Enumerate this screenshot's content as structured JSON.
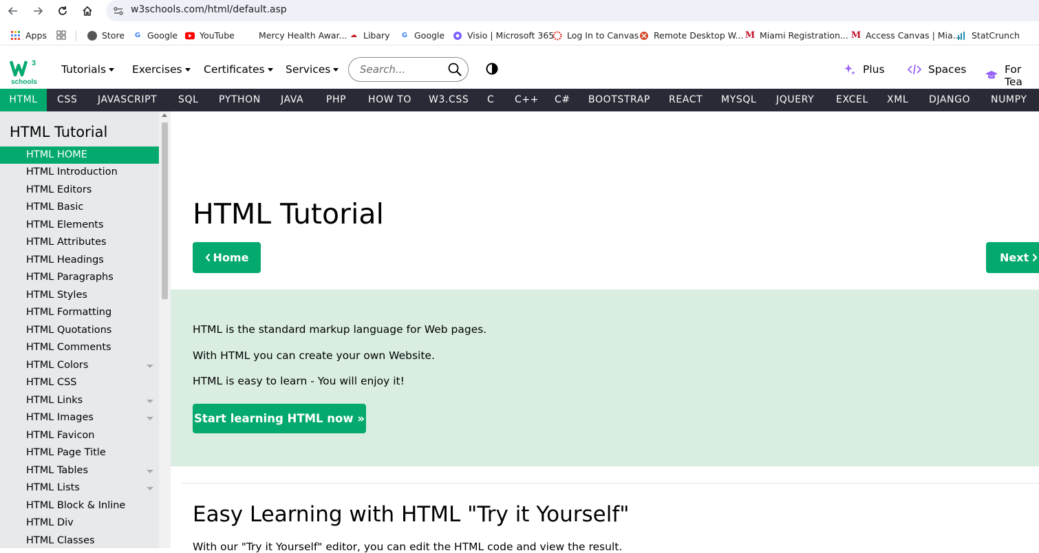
{
  "browser": {
    "url": "w3schools.com/html/default.asp",
    "bookmarks": [
      "Apps",
      "Store",
      "Google",
      "YouTube",
      "Mercy Health Awar...",
      "Libary",
      "Google",
      "Visio | Microsoft 365",
      "Log In to Canvas",
      "Remote Desktop W...",
      "Miami Registration...",
      "Access Canvas | Mia...",
      "StatCrunch"
    ]
  },
  "topnav": {
    "menus": [
      "Tutorials",
      "Exercises",
      "Certificates",
      "Services"
    ],
    "search_placeholder": "Search...",
    "right_links": [
      "Plus",
      "Spaces",
      "For Tea"
    ]
  },
  "subjects": [
    "HTML",
    "CSS",
    "JAVASCRIPT",
    "SQL",
    "PYTHON",
    "JAVA",
    "PHP",
    "HOW TO",
    "W3.CSS",
    "C",
    "C++",
    "C#",
    "BOOTSTRAP",
    "REACT",
    "MYSQL",
    "JQUERY",
    "EXCEL",
    "XML",
    "DJANGO",
    "NUMPY"
  ],
  "sidebar": {
    "title": "HTML Tutorial",
    "items": [
      "HTML HOME",
      "HTML Introduction",
      "HTML Editors",
      "HTML Basic",
      "HTML Elements",
      "HTML Attributes",
      "HTML Headings",
      "HTML Paragraphs",
      "HTML Styles",
      "HTML Formatting",
      "HTML Quotations",
      "HTML Comments",
      "HTML Colors",
      "HTML CSS",
      "HTML Links",
      "HTML Images",
      "HTML Favicon",
      "HTML Page Title",
      "HTML Tables",
      "HTML Lists",
      "HTML Block & Inline",
      "HTML Div",
      "HTML Classes"
    ]
  },
  "main": {
    "title": "HTML Tutorial",
    "home_button": "Home",
    "next_button": "Next",
    "intro": [
      "HTML is the standard markup language for Web pages.",
      "With HTML you can create your own Website.",
      "HTML is easy to learn - You will enjoy it!"
    ],
    "start_button": "Start learning HTML now »",
    "section_heading": "Easy Learning with HTML \"Try it Yourself\"",
    "section_cut_text": "With our \"Try it Yourself\" editor, you can edit the HTML code and view the result."
  },
  "colors": {
    "accent": "#04aa6d",
    "dark_bar": "#282a35",
    "sidebar_bg": "#e7e9eb",
    "intro_bg": "#d9eee1",
    "purple": "#9763f6"
  }
}
